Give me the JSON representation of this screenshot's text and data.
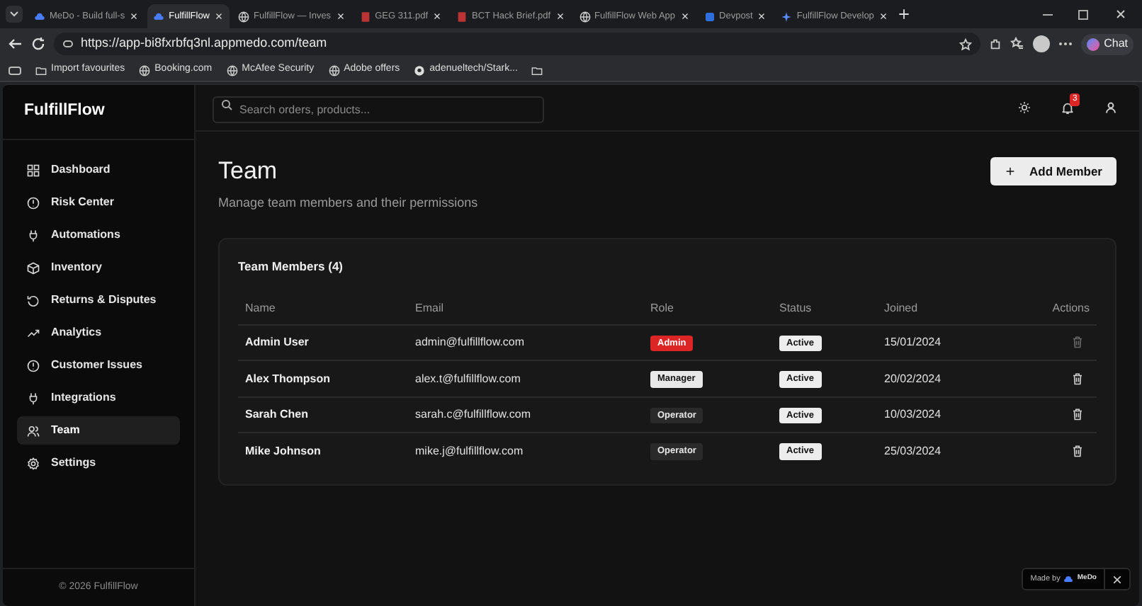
{
  "browser": {
    "tabs": [
      {
        "title": "MeDo - Build full-s",
        "selected": false
      },
      {
        "title": "FulfillFlow",
        "selected": true
      },
      {
        "title": "FulfillFlow — Inves",
        "selected": false
      },
      {
        "title": "GEG 311.pdf",
        "selected": false
      },
      {
        "title": "BCT Hack Brief.pdf",
        "selected": false
      },
      {
        "title": "FulfillFlow Web App",
        "selected": false
      },
      {
        "title": "Devpost",
        "selected": false
      },
      {
        "title": "FulfillFlow Develop",
        "selected": false
      }
    ],
    "url": "https://app-bi8fxrbfq3nl.appmedo.com/team",
    "chat_label": "Chat",
    "bookmarks": [
      "Import favourites",
      "Booking.com",
      "McAfee Security",
      "Adobe offers",
      "adenueltech/Stark..."
    ]
  },
  "sidebar": {
    "brand": "FulfillFlow",
    "items": [
      {
        "label": "Dashboard",
        "selected": false
      },
      {
        "label": "Risk Center",
        "selected": false
      },
      {
        "label": "Automations",
        "selected": false
      },
      {
        "label": "Inventory",
        "selected": false
      },
      {
        "label": "Returns & Disputes",
        "selected": false
      },
      {
        "label": "Analytics",
        "selected": false
      },
      {
        "label": "Customer Issues",
        "selected": false
      },
      {
        "label": "Integrations",
        "selected": false
      },
      {
        "label": "Team",
        "selected": true
      },
      {
        "label": "Settings",
        "selected": false
      }
    ],
    "footer": "© 2026 FulfillFlow"
  },
  "topbar": {
    "search_placeholder": "Search orders, products...",
    "notification_count": "3"
  },
  "page": {
    "title": "Team",
    "subtitle": "Manage team members and their permissions",
    "add_button": "Add Member"
  },
  "table": {
    "title": "Team Members (4)",
    "columns": [
      "Name",
      "Email",
      "Role",
      "Status",
      "Joined",
      "Actions"
    ],
    "rows": [
      {
        "name": "Admin User",
        "email": "admin@fulfillflow.com",
        "role": {
          "label": "Admin",
          "kind": "admin"
        },
        "status": "Active",
        "joined": "15/01/2024",
        "delete_disabled": true
      },
      {
        "name": "Alex Thompson",
        "email": "alex.t@fulfillflow.com",
        "role": {
          "label": "Manager",
          "kind": "manager"
        },
        "status": "Active",
        "joined": "20/02/2024",
        "delete_disabled": false
      },
      {
        "name": "Sarah Chen",
        "email": "sarah.c@fulfillflow.com",
        "role": {
          "label": "Operator",
          "kind": "operator"
        },
        "status": "Active",
        "joined": "10/03/2024",
        "delete_disabled": false
      },
      {
        "name": "Mike Johnson",
        "email": "mike.j@fulfillflow.com",
        "role": {
          "label": "Operator",
          "kind": "operator"
        },
        "status": "Active",
        "joined": "25/03/2024",
        "delete_disabled": false
      }
    ]
  },
  "badge": {
    "prefix": "Made by",
    "brand": "MeDo"
  }
}
